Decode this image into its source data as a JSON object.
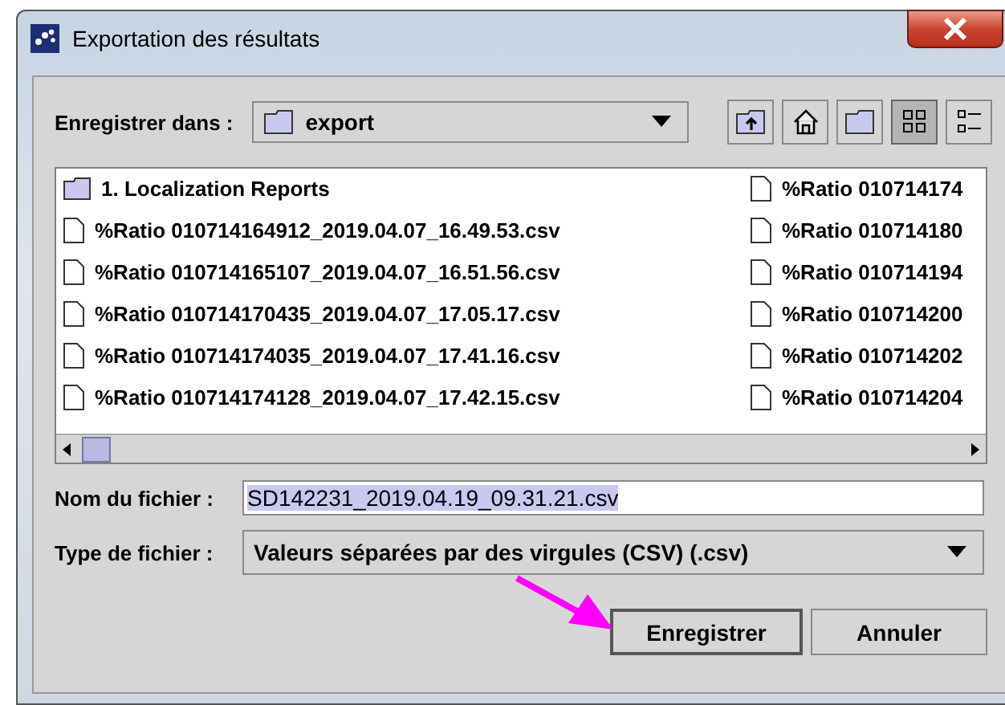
{
  "window": {
    "title": "Exportation des résultats"
  },
  "save_in": {
    "label": "Enregistrer dans :",
    "value": "export"
  },
  "toolbar": [
    {
      "kind": "up",
      "selected": false
    },
    {
      "kind": "home",
      "selected": false
    },
    {
      "kind": "newfolder",
      "selected": false
    },
    {
      "kind": "list",
      "selected": true
    },
    {
      "kind": "details",
      "selected": false
    }
  ],
  "files": [
    {
      "kind": "folder",
      "name": "1. Localization Reports"
    },
    {
      "kind": "file",
      "name": "%Ratio 010714164912_2019.04.07_16.49.53.csv"
    },
    {
      "kind": "file",
      "name": "%Ratio 010714165107_2019.04.07_16.51.56.csv"
    },
    {
      "kind": "file",
      "name": "%Ratio 010714170435_2019.04.07_17.05.17.csv"
    },
    {
      "kind": "file",
      "name": "%Ratio 010714174035_2019.04.07_17.41.16.csv"
    },
    {
      "kind": "file",
      "name": "%Ratio 010714174128_2019.04.07_17.42.15.csv"
    },
    {
      "kind": "file",
      "name": "%Ratio 010714174"
    },
    {
      "kind": "file",
      "name": "%Ratio 010714180"
    },
    {
      "kind": "file",
      "name": "%Ratio 010714194"
    },
    {
      "kind": "file",
      "name": "%Ratio 010714200"
    },
    {
      "kind": "file",
      "name": "%Ratio 010714202"
    },
    {
      "kind": "file",
      "name": "%Ratio 010714204"
    }
  ],
  "file_name": {
    "label": "Nom du fichier :",
    "value": "SD142231_2019.04.19_09.31.21.csv",
    "selected": true
  },
  "file_type": {
    "label": "Type de fichier :",
    "value": "Valeurs séparées par des virgules (CSV) (.csv)"
  },
  "buttons": [
    {
      "label": "Enregistrer",
      "default": true
    },
    {
      "label": "Annuler",
      "default": false
    }
  ]
}
